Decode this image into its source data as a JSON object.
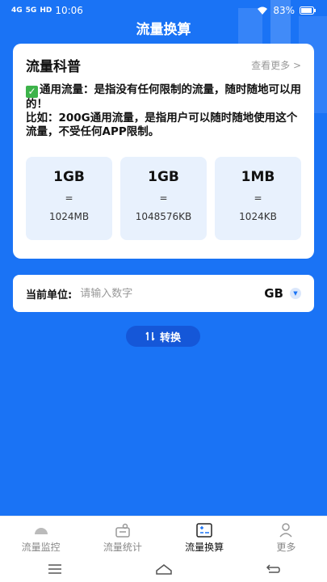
{
  "status_bar": {
    "signal1": "4G",
    "signal2": "5G",
    "hd": "HD",
    "time": "10:06",
    "battery": "83%"
  },
  "app_title": "流量换算",
  "card": {
    "title": "流量科普",
    "more": "查看更多 >",
    "desc_line1": "通用流量：是指没有任何限制的流量，随时随地可以用的！",
    "desc_line2": "比如：200G通用流量，是指用户可以随时随地使用这个流量，不受任何APP限制。",
    "units": [
      {
        "big": "1GB",
        "eq": "=",
        "small": "1024MB"
      },
      {
        "big": "1GB",
        "eq": "=",
        "small": "1048576KB"
      },
      {
        "big": "1MB",
        "eq": "=",
        "small": "1024KB"
      }
    ]
  },
  "converter": {
    "label": "当前单位:",
    "placeholder": "请输入数字",
    "unit": "GB",
    "button": "转换"
  },
  "tabs": [
    {
      "label": "流量监控",
      "icon": "monitor-icon"
    },
    {
      "label": "流量统计",
      "icon": "stats-icon"
    },
    {
      "label": "流量换算",
      "icon": "convert-icon"
    },
    {
      "label": "更多",
      "icon": "user-icon"
    }
  ],
  "colors": {
    "accent": "#1a73f5",
    "button": "#1557d8",
    "unit_box": "#e8f1fd"
  }
}
